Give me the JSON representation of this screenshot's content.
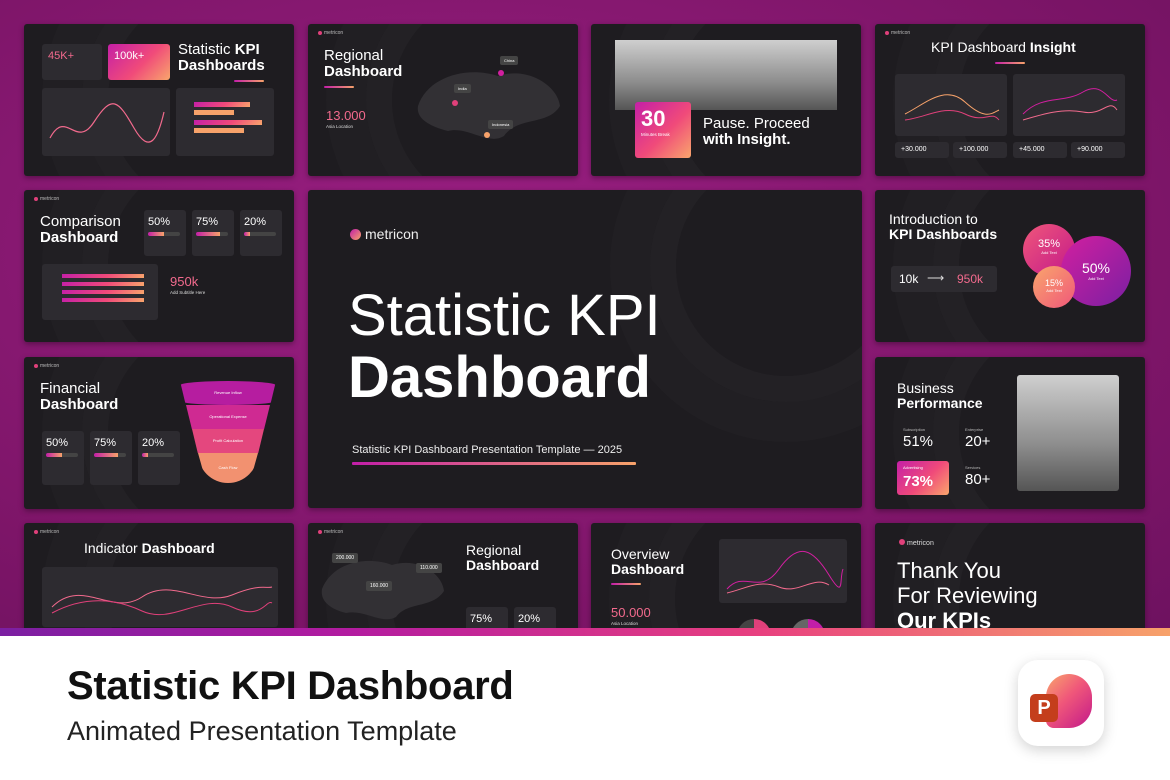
{
  "page": {
    "main_title": "Statistic KPI Dashboard",
    "subtitle": "Animated Presentation Template"
  },
  "colors": {
    "background": "#8a1a72",
    "slide_bg": "#1e1c20",
    "accent_start": "#c21ea8",
    "accent_end": "#f7a26a"
  },
  "icon": "powerpoint-app-icon",
  "icon_letter": "P",
  "hero": {
    "brand": "metricon",
    "title_line1": "Statistic KPI",
    "title_line2": "Dashboard",
    "tagline": "Statistic KPI Dashboard Presentation Template — 2025"
  },
  "slides": {
    "s1": {
      "stat_a": "45K+",
      "stat_b": "100k+",
      "title_1": "Statistic ",
      "title_1b": "KPI",
      "title_2": "Dashboards"
    },
    "s2": {
      "title_1": "Regional",
      "title_2": "Dashboard",
      "stat": "13.000",
      "stat_label": "Asia Location",
      "pin_1": "China",
      "pin_2": "India",
      "pin_3": "Indonesia"
    },
    "s3": {
      "stat": "30",
      "stat_label": "Minutes Break",
      "title_1": "Pause. Proceed",
      "title_2": "with Insight."
    },
    "s4": {
      "title_1": "KPI Dashboard ",
      "title_2": "Insight",
      "values": [
        "+30.000",
        "+100.000",
        "+45.000",
        "+90.000"
      ]
    },
    "s5": {
      "title_1": "Comparison",
      "title_2": "Dashboard",
      "pcts": [
        "50%",
        "75%",
        "20%"
      ],
      "stat": "950k",
      "stat_label": "Add Subtitle Here"
    },
    "s6": {
      "title_1": "Introduction to",
      "title_2": "KPI Dashboards",
      "from": "10k",
      "to": "950k",
      "bubbles": [
        "35%",
        "50%",
        "15%"
      ],
      "bubble_label": "Add Text"
    },
    "s7": {
      "title_1": "Financial",
      "title_2": "Dashboard",
      "pcts": [
        "50%",
        "75%",
        "20%"
      ],
      "funnel": [
        "Revenue Inflow",
        "Operational Expense",
        "Profit Calculation",
        "Cash Flow"
      ]
    },
    "s8": {
      "title_1": "Business",
      "title_2": "Performance",
      "m1_label": "Subscription",
      "m1": "51%",
      "m2_label": "Enterprise",
      "m2": "20+",
      "m3_label": "Advertising",
      "m3": "73%",
      "m4_label": "Services",
      "m4": "80+"
    },
    "s9": {
      "title_1": "Indicator ",
      "title_2": "Dashboard"
    },
    "s10": {
      "title_1": "Regional",
      "title_2": "Dashboard",
      "pins": [
        "200.000",
        "160.000",
        "110.000"
      ],
      "pcts": [
        "75%",
        "20%"
      ]
    },
    "s11": {
      "title_1": "Overview",
      "title_2": "Dashboard",
      "stat": "50.000",
      "stat_label": "Asia Location"
    },
    "s12": {
      "brand": "metricon",
      "line1": "Thank You",
      "line2": "For Reviewing",
      "line3": "Our KPIs"
    }
  }
}
